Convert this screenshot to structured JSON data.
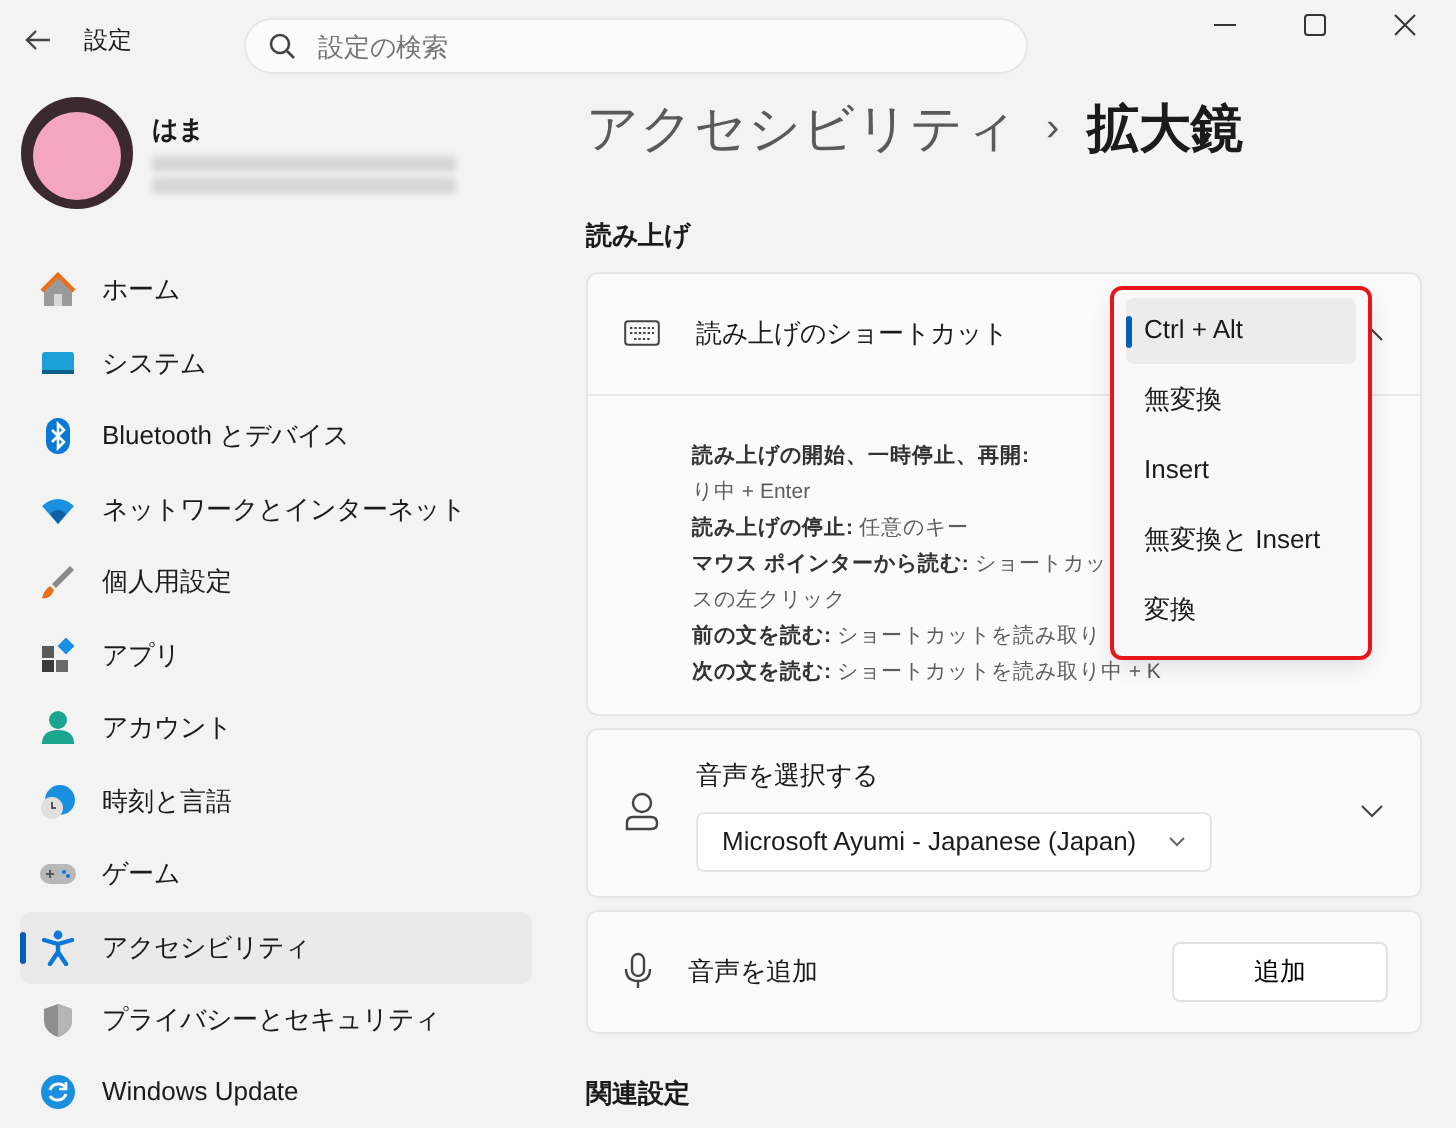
{
  "window": {
    "title": "設定"
  },
  "search": {
    "placeholder": "設定の検索"
  },
  "profile": {
    "name": "はま"
  },
  "sidebar": {
    "items": [
      {
        "label": "ホーム",
        "kind": "home",
        "selected": false
      },
      {
        "label": "システム",
        "kind": "system",
        "selected": false
      },
      {
        "label": "Bluetooth とデバイス",
        "kind": "bluetooth",
        "selected": false
      },
      {
        "label": "ネットワークとインターネット",
        "kind": "wifi",
        "selected": false
      },
      {
        "label": "個人用設定",
        "kind": "brush",
        "selected": false
      },
      {
        "label": "アプリ",
        "kind": "apps",
        "selected": false
      },
      {
        "label": "アカウント",
        "kind": "account",
        "selected": false
      },
      {
        "label": "時刻と言語",
        "kind": "time",
        "selected": false
      },
      {
        "label": "ゲーム",
        "kind": "game",
        "selected": false
      },
      {
        "label": "アクセシビリティ",
        "kind": "accessibility",
        "selected": true
      },
      {
        "label": "プライバシーとセキュリティ",
        "kind": "shield",
        "selected": false
      },
      {
        "label": "Windows Update",
        "kind": "update",
        "selected": false
      }
    ]
  },
  "breadcrumb": {
    "parent": "アクセシビリティ",
    "separator": "›",
    "current": "拡大鏡"
  },
  "section": {
    "title": "読み上げ"
  },
  "shortcut_card": {
    "title": "読み上げのショートカット",
    "expanded": true,
    "description": [
      "**読み上げの開始、一時停止、再開:**",
      "り中 + Enter",
      "**読み上げの停止:** 任意のキー",
      "**マウス ポインターから読む:** ショートカッ",
      "スの左クリック",
      "**前の文を読む:** ショートカットを読み取り",
      "**次の文を読む:** ショートカットを読み取り中 + K"
    ],
    "dropdown": {
      "annotated": true,
      "options": [
        {
          "label": "Ctrl + Alt",
          "selected": true
        },
        {
          "label": "無変換",
          "selected": false
        },
        {
          "label": "Insert",
          "selected": false
        },
        {
          "label": "無変換と Insert",
          "selected": false
        },
        {
          "label": "変換",
          "selected": false
        }
      ]
    }
  },
  "voice_card": {
    "title": "音声を選択する",
    "value": "Microsoft Ayumi - Japanese (Japan)",
    "expanded": false
  },
  "add_voice_card": {
    "title": "音声を追加",
    "button": "追加"
  },
  "related": {
    "title": "関連設定"
  }
}
